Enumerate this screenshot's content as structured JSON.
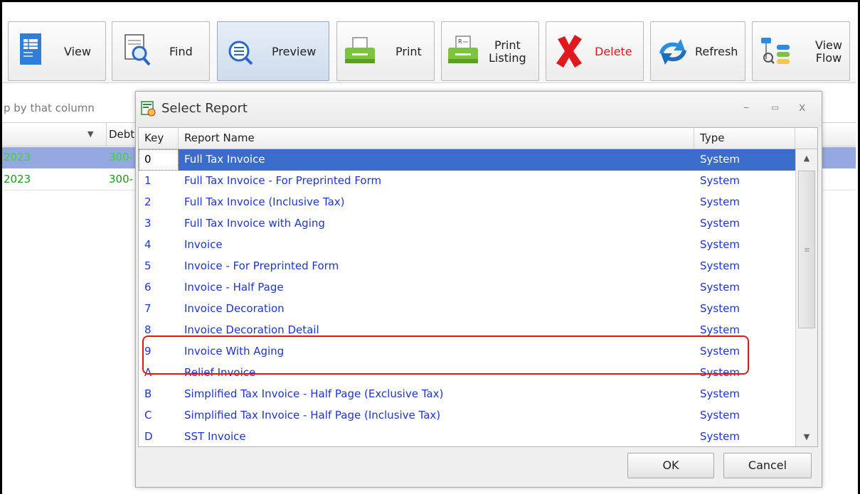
{
  "toolbar": {
    "buttons": [
      {
        "label": "View",
        "icon": "view-icon"
      },
      {
        "label": "Find",
        "icon": "find-icon"
      },
      {
        "label": "Preview",
        "icon": "preview-icon"
      },
      {
        "label": "Print",
        "icon": "print-icon"
      },
      {
        "label": "Print Listing",
        "label_line1": "Print",
        "label_line2": "Listing",
        "icon": "print-listing-icon"
      },
      {
        "label": "Delete",
        "icon": "delete-icon",
        "color": "#e0191f"
      },
      {
        "label": "Refresh",
        "icon": "refresh-icon"
      },
      {
        "label": "View Flow",
        "label_line1": "View",
        "label_line2": "Flow",
        "icon": "view-flow-icon"
      }
    ]
  },
  "grid": {
    "group_hint": "p by that column",
    "header_col2": "Debt",
    "rows": [
      {
        "c1": "2023",
        "c2": "300-",
        "selected": true
      },
      {
        "c1": "2023",
        "c2": "300-",
        "selected": false
      }
    ]
  },
  "dialog": {
    "title": "Select Report",
    "controls": {
      "minimize": "–",
      "maximize": "▭",
      "close": "x"
    },
    "columns": {
      "key": "Key",
      "name": "Report Name",
      "type": "Type"
    },
    "rows": [
      {
        "key": "0",
        "name": "Full Tax Invoice",
        "type": "System",
        "selected": true
      },
      {
        "key": "1",
        "name": "Full Tax Invoice - For Preprinted Form",
        "type": "System"
      },
      {
        "key": "2",
        "name": "Full Tax Invoice (Inclusive Tax)",
        "type": "System"
      },
      {
        "key": "3",
        "name": "Full Tax Invoice with Aging",
        "type": "System"
      },
      {
        "key": "4",
        "name": "Invoice",
        "type": "System"
      },
      {
        "key": "5",
        "name": "Invoice - For Preprinted Form",
        "type": "System"
      },
      {
        "key": "6",
        "name": "Invoice - Half Page",
        "type": "System"
      },
      {
        "key": "7",
        "name": "Invoice Decoration",
        "type": "System"
      },
      {
        "key": "8",
        "name": "Invoice Decoration Detail",
        "type": "System"
      },
      {
        "key": "9",
        "name": "Invoice With Aging",
        "type": "System"
      },
      {
        "key": "A",
        "name": "Relief Invoice",
        "type": "System"
      },
      {
        "key": "B",
        "name": "Simplified Tax Invoice - Half Page (Exclusive Tax)",
        "type": "System"
      },
      {
        "key": "C",
        "name": "Simplified Tax Invoice - Half Page (Inclusive Tax)",
        "type": "System"
      },
      {
        "key": "D",
        "name": "SST Invoice",
        "type": "System"
      }
    ],
    "ok_label": "OK",
    "cancel_label": "Cancel"
  },
  "colors": {
    "link_blue": "#1d34d8",
    "selection_blue": "#3a6ccc",
    "highlight_red": "#e01818",
    "delete_red": "#e0191f"
  }
}
